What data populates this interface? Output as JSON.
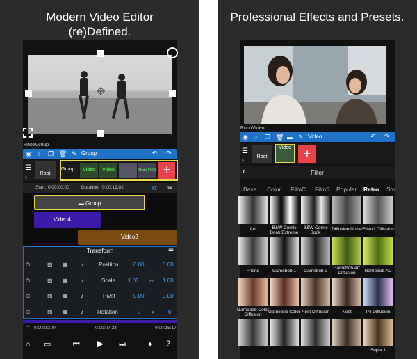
{
  "left": {
    "headline_line1": "Modern Video Editor",
    "headline_line2": "(re)Defined.",
    "breadcrumb": "Root/Group",
    "toolbar_label": "Group",
    "tracks": {
      "root_label": "Root",
      "group_label": "Group",
      "video_labels": [
        "Video",
        "Video"
      ],
      "extra_label": "Node.FX01"
    },
    "start_label": "Start:",
    "start_value": "0:00:00:00",
    "duration_label": "Duration:",
    "duration_value": "0:00:12:02",
    "timeline": {
      "group_clip": "Group",
      "video4_clip": "Video4",
      "video2_clip": "Video2"
    },
    "transform": {
      "title": "Transform",
      "rows": [
        {
          "label": "Position",
          "v1": "0.00",
          "v2": "0.00"
        },
        {
          "label": "Scale",
          "v1": "1.00",
          "v2": "1.00"
        },
        {
          "label": "Pivot",
          "v1": "0.00",
          "v2": "0.00"
        },
        {
          "label": "Rotation",
          "v1": "0",
          "v2": "0"
        }
      ],
      "x_label": "x"
    },
    "time_ruler": [
      "0:00:00:00",
      "0:00:07:23",
      "0:00:15:17"
    ]
  },
  "right": {
    "headline": "Professional Effects and Presets.",
    "breadcrumb": "Root/Video",
    "toolbar_label": "Video",
    "root_label": "Root",
    "video_thumb_label": "Video",
    "filter_title": "Filter",
    "categories": [
      "Base",
      "Color",
      "FilmC",
      "FilmS",
      "Popular",
      "Retro",
      "Sto"
    ],
    "active_category": "Retro",
    "filters": [
      [
        "Atri",
        "B&W Comic Book Extreme",
        "B&W Comic Book",
        "Diffusion Noise",
        "Friend Diffusion"
      ],
      [
        "Friend",
        "Gamebob 1",
        "Gamebob 2",
        "Gamebob AC Diffusion",
        "Gamebob AC"
      ],
      [
        "Gamebob Color Diffusion",
        "Gamebob Color",
        "Nest Diffusion",
        "Nest",
        "P4 Diffusion"
      ]
    ],
    "last_row_partial": "Sepia 1"
  },
  "colors": {
    "accent_blue": "#1e73c8",
    "highlight_yellow": "#e6d84a",
    "add_red": "#e8434b",
    "video_clip_purple": "#3b1aa8",
    "video_clip_orange": "#7a4a10",
    "value_blue": "#4aa3ff"
  }
}
